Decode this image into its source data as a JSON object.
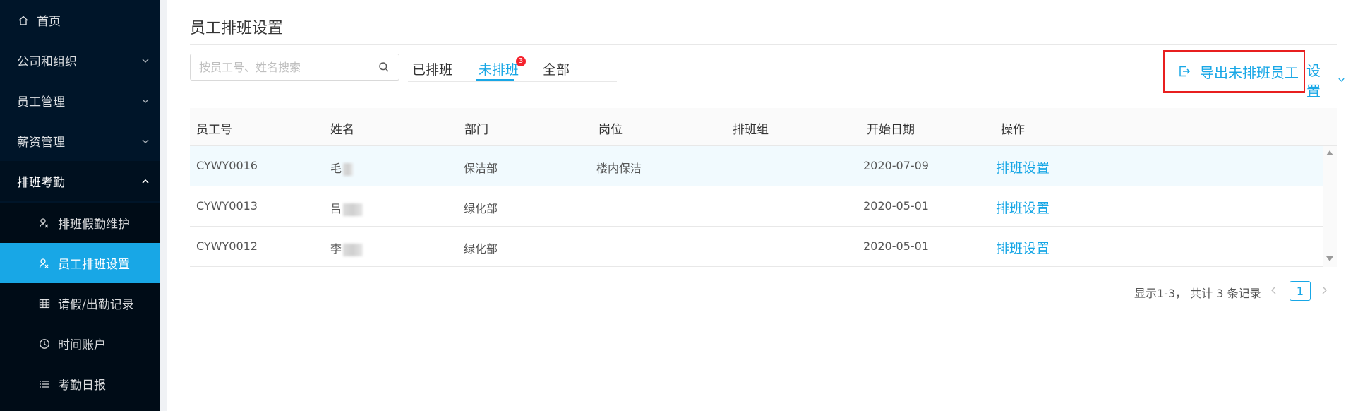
{
  "sidebar": {
    "items": [
      {
        "label": "首页",
        "icon": "home-icon"
      },
      {
        "label": "公司和组织",
        "icon": "chevron-down-icon"
      },
      {
        "label": "员工管理",
        "icon": "chevron-down-icon"
      },
      {
        "label": "薪资管理",
        "icon": "chevron-down-icon"
      },
      {
        "label": "排班考勤",
        "icon": "chevron-up-icon"
      }
    ],
    "subitems": [
      {
        "label": "排班假勤维护",
        "icon": "schedule-icon"
      },
      {
        "label": "员工排班设置",
        "icon": "schedule-icon",
        "active": true
      },
      {
        "label": "请假/出勤记录",
        "icon": "table-icon"
      },
      {
        "label": "时间账户",
        "icon": "clock-icon"
      },
      {
        "label": "考勤日报",
        "icon": "list-icon"
      }
    ]
  },
  "page": {
    "title": "员工排班设置"
  },
  "search": {
    "placeholder": "按员工号、姓名搜索",
    "value": ""
  },
  "tabs": [
    {
      "label": "已排班"
    },
    {
      "label": "未排班",
      "active": true,
      "badge": "3"
    },
    {
      "label": "全部"
    }
  ],
  "actions": {
    "export_label": "导出未排班员工",
    "settings_label": "设置"
  },
  "table": {
    "columns": [
      "员工号",
      "姓名",
      "部门",
      "岗位",
      "排班组",
      "开始日期",
      "操作"
    ],
    "rows": [
      {
        "id": "CYWY0016",
        "name": "毛",
        "dept": "保洁部",
        "post": "楼内保洁",
        "group": "",
        "start": "2020-07-09",
        "action": "排班设置"
      },
      {
        "id": "CYWY0013",
        "name": "吕",
        "dept": "绿化部",
        "post": "",
        "group": "",
        "start": "2020-05-01",
        "action": "排班设置"
      },
      {
        "id": "CYWY0012",
        "name": "李",
        "dept": "绿化部",
        "post": "",
        "group": "",
        "start": "2020-05-01",
        "action": "排班设置"
      }
    ]
  },
  "pagination": {
    "info": "显示1-3， 共计 3 条记录",
    "current_page": "1"
  },
  "colors": {
    "sidebar_bg": "#001529",
    "accent": "#18a7e6",
    "highlight_border": "#e81f1f",
    "badge": "#f5222d"
  }
}
